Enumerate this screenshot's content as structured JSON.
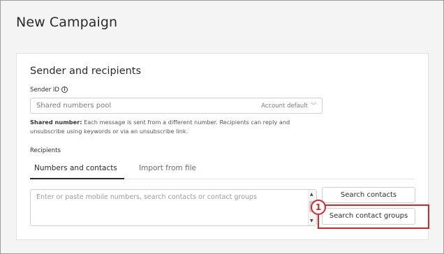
{
  "page": {
    "title": "New Campaign"
  },
  "sender": {
    "section_title": "Sender and recipients",
    "sender_id_label": "Sender ID",
    "select_value": "Shared numbers pool",
    "select_hint": "Account default",
    "help_strong": "Shared number:",
    "help_text": " Each message is sent from a different number. Recipients can reply and unsubscribe using keywords or via an unsubscribe link."
  },
  "recipients": {
    "label": "Recipients",
    "tabs": [
      {
        "label": "Numbers and contacts",
        "active": true
      },
      {
        "label": "Import from file",
        "active": false
      }
    ],
    "placeholder": "Enter or paste mobile numbers, search contacts or contact groups",
    "search_contacts_label": "Search contacts",
    "search_groups_label": "Search contact groups"
  },
  "annotation": {
    "step": "1",
    "color": "#d9252a"
  },
  "icons": {
    "info": "info-icon",
    "chevron": "chevron-down-icon",
    "scroll_up": "arrow-up-icon",
    "scroll_down": "arrow-down-icon"
  }
}
